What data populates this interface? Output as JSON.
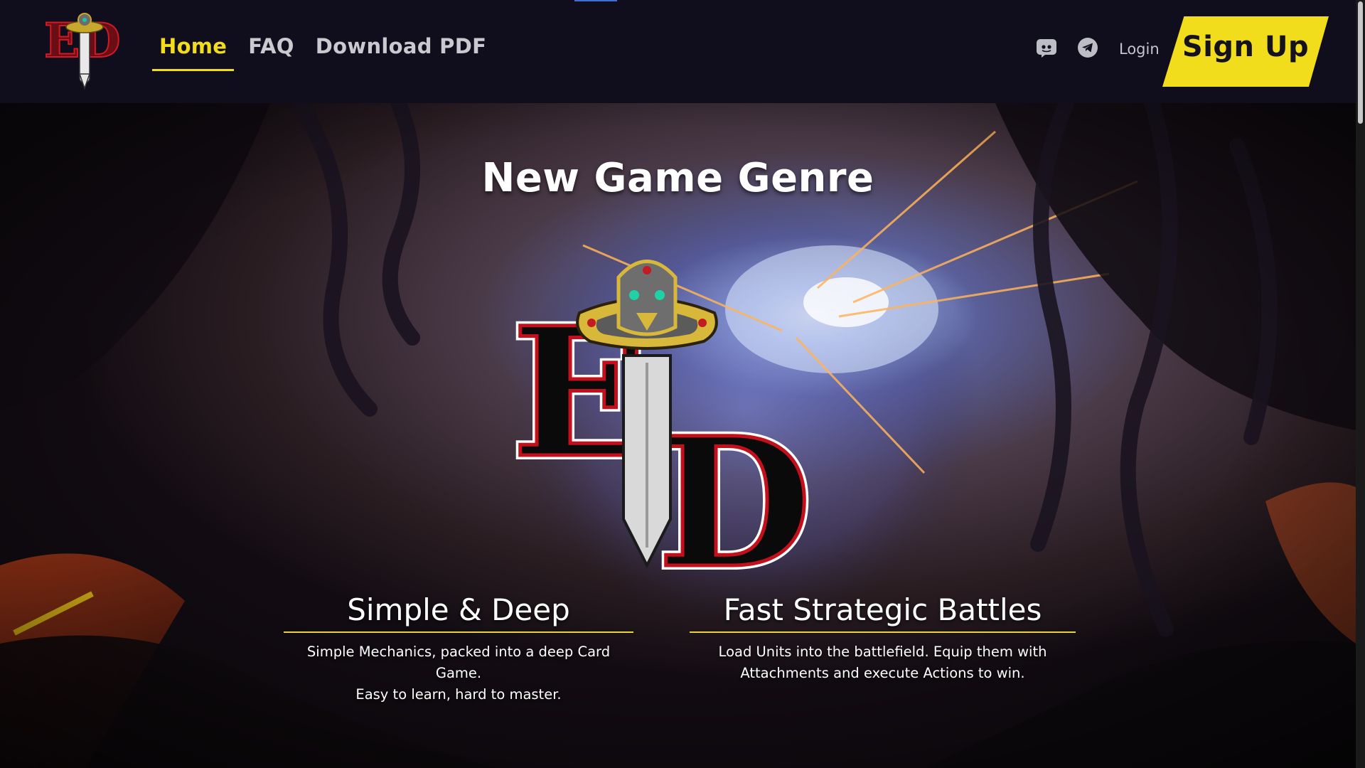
{
  "header": {
    "logo_text": "ED",
    "nav": [
      {
        "label": "Home",
        "active": true
      },
      {
        "label": "FAQ",
        "active": false
      },
      {
        "label": "Download PDF",
        "active": false
      }
    ],
    "social_icons": [
      "discord-icon",
      "telegram-icon"
    ],
    "login_label": "Login",
    "signup_label": "Sign Up"
  },
  "hero": {
    "title": "New Game Genre",
    "logo_text": "ED",
    "features": [
      {
        "title": "Simple & Deep",
        "lines": [
          "Simple Mechanics, packed into a deep Card Game.",
          "Easy to learn, hard to master."
        ]
      },
      {
        "title": "Fast Strategic Battles",
        "lines": [
          "Load Units into the battlefield. Equip them with",
          "Attachments and execute Actions to win."
        ]
      }
    ]
  },
  "colors": {
    "accent": "#f2dd1c",
    "header_bg": "#100d1c",
    "nav_text": "#c9c9cf",
    "logo_red": "#c4101c"
  }
}
